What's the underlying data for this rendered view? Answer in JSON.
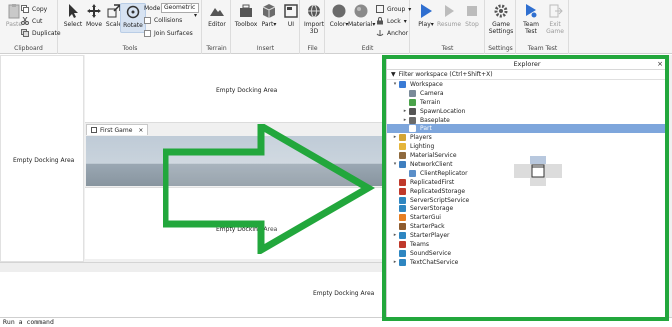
{
  "ribbon": {
    "clipboard": {
      "paste": "Paste",
      "copy": "Copy",
      "cut": "Cut",
      "duplicate": "Duplicate",
      "label": "Clipboard"
    },
    "tools": {
      "select": "Select",
      "move": "Move",
      "scale": "Scale",
      "rotate": "Rotate",
      "label": "Tools",
      "mode_label": "Mode:",
      "mode_value": "Geometric",
      "collisions": "Collisions",
      "join_surfaces": "Join Surfaces"
    },
    "terrain": {
      "editor": "Editor",
      "label": "Terrain"
    },
    "insert": {
      "toolbox": "Toolbox",
      "part": "Part",
      "ui": "UI",
      "label": "Insert"
    },
    "file": {
      "import3d_line1": "Import",
      "import3d_line2": "3D",
      "label": "File"
    },
    "edit": {
      "color": "Color",
      "material": "Material",
      "group": "Group",
      "lock": "Lock",
      "anchor": "Anchor",
      "label": "Edit"
    },
    "test": {
      "play": "Play",
      "resume": "Resume",
      "stop": "Stop",
      "label": "Test"
    },
    "settings": {
      "game_line1": "Game",
      "game_line2": "Settings",
      "label": "Settings"
    },
    "team_test": {
      "team_line1": "Team",
      "team_line2": "Test",
      "exit_line1": "Exit",
      "exit_line2": "Game",
      "label": "Team Test"
    }
  },
  "docking": {
    "top": "Empty Docking Area",
    "left": "Empty Docking Area",
    "middle": "Empty Docking Area",
    "bottom": "Empty Docking Area"
  },
  "viewport_tab": {
    "label": "First Game",
    "close": "×"
  },
  "explorer": {
    "title": "Explorer",
    "close": "×",
    "filter_placeholder": "Filter workspace (Ctrl+Shift+X)",
    "items": [
      {
        "label": "Workspace",
        "depth": 0,
        "arrow": "▾",
        "color": "#3a7bd5"
      },
      {
        "label": "Camera",
        "depth": 1,
        "arrow": "",
        "color": "#7a8a99"
      },
      {
        "label": "Terrain",
        "depth": 1,
        "arrow": "",
        "color": "#4aa34a"
      },
      {
        "label": "SpawnLocation",
        "depth": 1,
        "arrow": "▸",
        "color": "#555555"
      },
      {
        "label": "Baseplate",
        "depth": 1,
        "arrow": "▸",
        "color": "#6b6b6b"
      },
      {
        "label": "Part",
        "depth": 1,
        "arrow": "",
        "color": "#ffffff",
        "selected": true
      },
      {
        "label": "Players",
        "depth": 0,
        "arrow": "▸",
        "color": "#d4a534"
      },
      {
        "label": "Lighting",
        "depth": 0,
        "arrow": "",
        "color": "#e5b53a"
      },
      {
        "label": "MaterialService",
        "depth": 0,
        "arrow": "",
        "color": "#8f6a3e"
      },
      {
        "label": "NetworkClient",
        "depth": 0,
        "arrow": "▾",
        "color": "#3f7fbf"
      },
      {
        "label": "ClientReplicator",
        "depth": 1,
        "arrow": "",
        "color": "#5b8fc9"
      },
      {
        "label": "ReplicatedFirst",
        "depth": 0,
        "arrow": "",
        "color": "#c0392b"
      },
      {
        "label": "ReplicatedStorage",
        "depth": 0,
        "arrow": "",
        "color": "#c0392b"
      },
      {
        "label": "ServerScriptService",
        "depth": 0,
        "arrow": "",
        "color": "#2e86c1"
      },
      {
        "label": "ServerStorage",
        "depth": 0,
        "arrow": "",
        "color": "#2e86c1"
      },
      {
        "label": "StarterGui",
        "depth": 0,
        "arrow": "",
        "color": "#e67e22"
      },
      {
        "label": "StarterPack",
        "depth": 0,
        "arrow": "",
        "color": "#8e5b2e"
      },
      {
        "label": "StarterPlayer",
        "depth": 0,
        "arrow": "▸",
        "color": "#2e86c1"
      },
      {
        "label": "Teams",
        "depth": 0,
        "arrow": "",
        "color": "#c0392b"
      },
      {
        "label": "SoundService",
        "depth": 0,
        "arrow": "",
        "color": "#2e86c1"
      },
      {
        "label": "TextChatService",
        "depth": 0,
        "arrow": "▸",
        "color": "#2e86c1"
      }
    ]
  },
  "command_bar": {
    "placeholder": "Run a command"
  },
  "colors": {
    "highlight": "#22a73c",
    "selection": "#7ea6dc"
  }
}
